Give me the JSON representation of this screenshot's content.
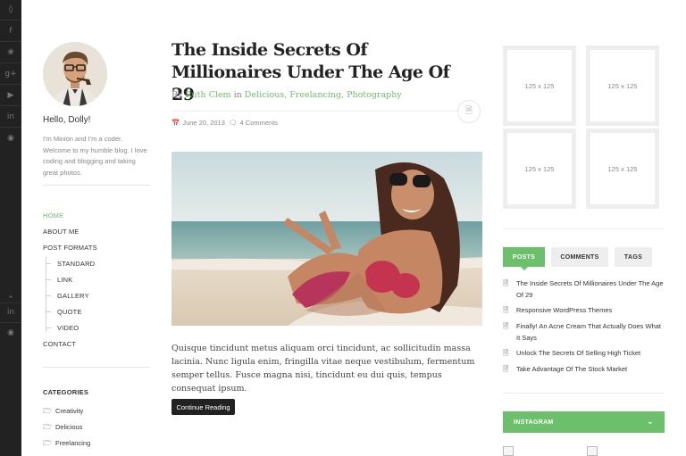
{
  "social_rail": {
    "icons": [
      "tag-icon",
      "facebook-icon",
      "twitter-icon",
      "google-plus-icon",
      "youtube-icon",
      "linkedin-icon",
      "github-icon",
      "chevron-up-icon",
      "linkedin-icon",
      "github-icon"
    ]
  },
  "profile": {
    "greeting": "Hello, Dolly!",
    "bio": "I'm Minion and I'm a coder. Welcome to my humble blog. I love coding and blogging and taking great photos."
  },
  "nav": {
    "home": "HOME",
    "about": "ABOUT ME",
    "post_formats": "POST FORMATS",
    "standard": "STANDARD",
    "link": "LINK",
    "gallery": "GALLERY",
    "quote": "QUOTE",
    "video": "VIDEO",
    "contact": "CONTACT"
  },
  "categories": {
    "heading": "CATEGORIES",
    "items": [
      "Creativity",
      "Delicious",
      "Freelancing"
    ]
  },
  "post": {
    "title": "The Inside Secrets Of Millionaires Under The Age Of 29",
    "by": "By",
    "author": "Ruth Clem",
    "in": "in",
    "cat1": "Delicious,",
    "cat2": "Freelancing,",
    "cat3": "Photography",
    "date": "June 20, 2013",
    "comments": "4 Comments",
    "excerpt": "Quisque tincidunt metus aliquam orci tincidunt, ac sollicitudin massa lacinia. Nunc ligula enim, fringilla vitae neque vestibulum, fermentum semper tellus. Fusce magna nisi, tincidunt eu dui quis, tempus consequat ipsum.",
    "read_more": "Continue Reading"
  },
  "ads": [
    "125 x 125",
    "125 x 125",
    "125 x 125",
    "125 x 125"
  ],
  "tabs": {
    "posts": "POSTS",
    "comments": "COMMENTS",
    "tags": "TAGS"
  },
  "popular_posts": [
    "The Inside Secrets Of Millionaires Under The Age Of 29",
    "Responsive WordPress Themes",
    "Finally! An Acne Cream That Actually Does What It Says",
    "Unlock The Secrets Of Selling High Ticket",
    "Take Advantage Of The Stock Market"
  ],
  "instagram": {
    "title": "INSTAGRAM"
  },
  "colors": {
    "accent": "#6cbf6b",
    "rail": "#222222",
    "button": "#222222"
  }
}
